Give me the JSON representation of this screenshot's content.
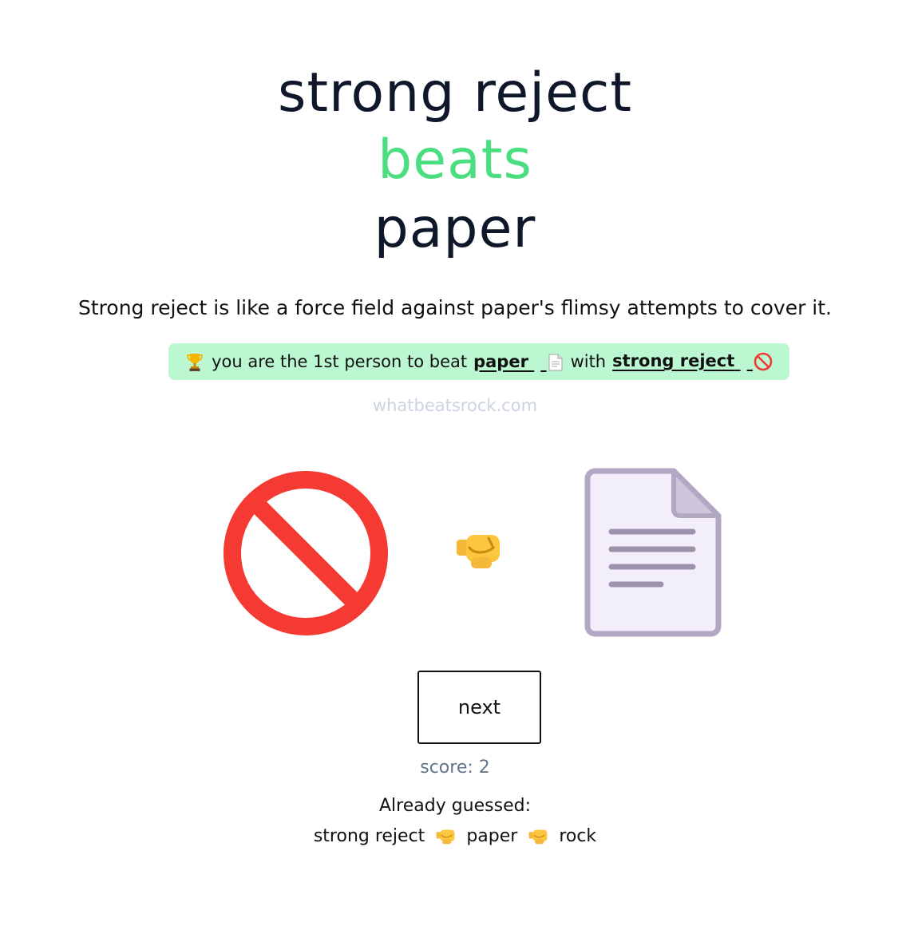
{
  "headline": {
    "new_item": "strong reject",
    "verb": "beats",
    "old_item": "paper",
    "verb_color": "#4ade80"
  },
  "explanation": "Strong reject is like a force field against paper's flimsy attempts to cover it.",
  "banner": {
    "prefix": "you are the 1st person to beat",
    "beaten_item": "paper",
    "middle": "with",
    "winner_item": "strong reject",
    "background": "#bbf7d0",
    "icons": [
      "trophy-icon",
      "page-icon",
      "prohibited-icon"
    ]
  },
  "site": "whatbeatsrock.com",
  "battle": {
    "left_icon": "prohibited-icon",
    "middle_icon": "fist-icon",
    "right_icon": "document-icon"
  },
  "next_button": {
    "label": "next"
  },
  "score": {
    "text": "score: 2"
  },
  "history": {
    "label": "Already guessed:",
    "items": [
      "strong reject",
      "paper",
      "rock"
    ],
    "separator_icon": "fist-icon"
  }
}
